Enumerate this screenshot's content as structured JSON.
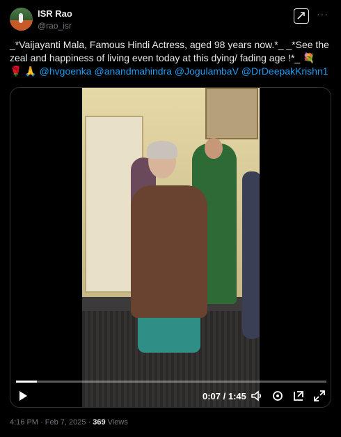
{
  "author": {
    "name": "ISR Rao",
    "handle": "@rao_isr"
  },
  "post": {
    "text_part1": "_*Vaijayanti Mala, Famous Hindi Actress, aged 98 years now.*_  _*See the zeal and happiness of living even today at this dying/ fading age !*_  💐",
    "text_part2": "🌹 🙏 ",
    "mentions": [
      "@hvgoenka",
      "@anandmahindra",
      "@JogulambaV",
      "@DrDeepakKrishn1"
    ]
  },
  "video": {
    "time_display": "0:07 / 1:45",
    "progress": 0.067
  },
  "footer": {
    "time": "4:16 PM",
    "separator": " · ",
    "date": "Feb 7, 2025",
    "views_count": "369",
    "views_label": "Views"
  },
  "colors": {
    "accent": "#1d9bf0",
    "background": "#000000",
    "text": "#e7e9ea",
    "muted": "#71767b"
  },
  "icons": [
    "grok-icon",
    "more-icon",
    "play-icon",
    "volume-icon",
    "settings-icon",
    "pip-icon",
    "fullscreen-icon"
  ]
}
